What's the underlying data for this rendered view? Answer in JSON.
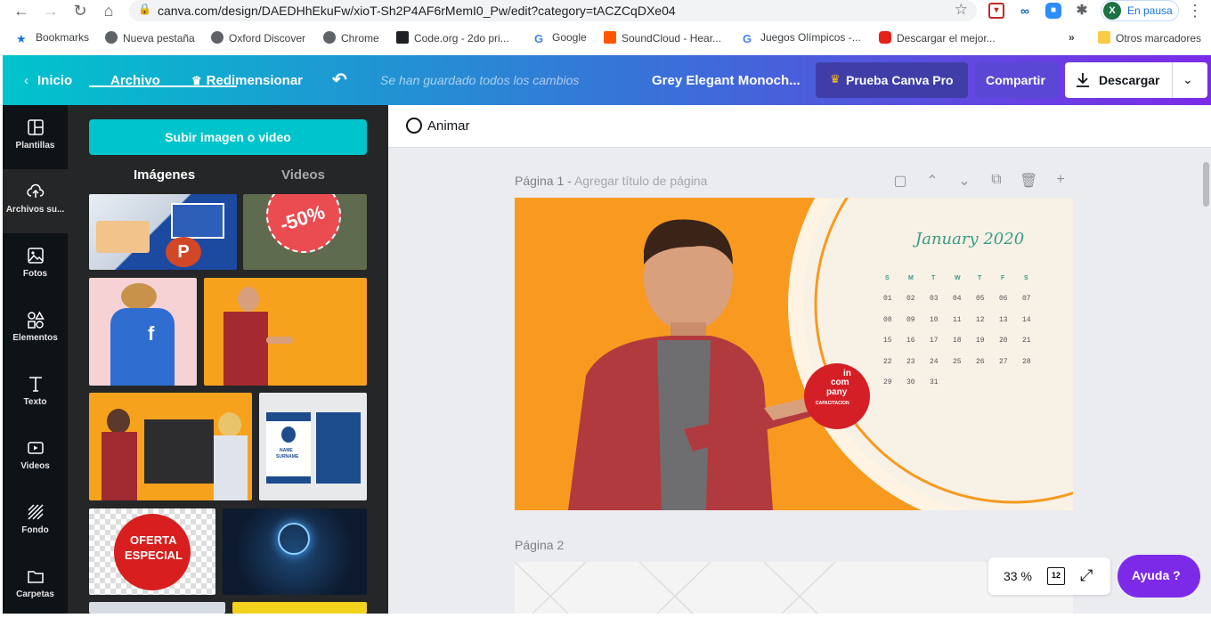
{
  "browser": {
    "url": "canva.com/design/DAEDHhEkuFw/xioT-Sh2P4AF6rMemI0_Pw/edit?category=tACZCqDXe04",
    "profile_status": "En pausa",
    "bookmarks": [
      {
        "label": "Bookmarks",
        "color": "#1a73e8"
      },
      {
        "label": "Nueva pestaña",
        "color": "#5f6368"
      },
      {
        "label": "Oxford Discover",
        "color": "#5f6368"
      },
      {
        "label": "Chrome",
        "color": "#5f6368"
      },
      {
        "label": "Code.org - 2do pri...",
        "color": "#202124"
      },
      {
        "label": "Google",
        "color": "#4285f4"
      },
      {
        "label": "SoundCloud - Hear...",
        "color": "#ff5500"
      },
      {
        "label": "Juegos Olímpicos -...",
        "color": "#4285f4"
      },
      {
        "label": "Descargar el mejor...",
        "color": "#e62117"
      }
    ],
    "more_bookmarks": "»",
    "other_bookmarks": "Otros marcadores"
  },
  "topbar": {
    "home": "Inicio",
    "file": "Archivo",
    "resize": "Redimensionar",
    "saved_status": "Se han guardado todos los cambios",
    "doc_title": "Grey Elegant Monoch...",
    "pro_button": "Prueba Canva Pro",
    "share_button": "Compartir",
    "download_button": "Descargar"
  },
  "sidebar": {
    "items": [
      {
        "label": "Plantillas",
        "icon": "templates-icon"
      },
      {
        "label": "Archivos su...",
        "icon": "upload-cloud-icon"
      },
      {
        "label": "Fotos",
        "icon": "photos-icon"
      },
      {
        "label": "Elementos",
        "icon": "elements-icon"
      },
      {
        "label": "Texto",
        "icon": "text-icon"
      },
      {
        "label": "Videos",
        "icon": "video-icon"
      },
      {
        "label": "Fondo",
        "icon": "background-icon"
      },
      {
        "label": "Carpetas",
        "icon": "folder-icon"
      }
    ]
  },
  "panel": {
    "upload_button": "Subir imagen o video",
    "tabs": [
      "Imágenes",
      "Videos"
    ],
    "thumb_texts": {
      "discount": "-50%",
      "offer": [
        "OFERTA",
        "ESPECIAL"
      ],
      "idcard": [
        "NAME",
        "SURNAME"
      ]
    }
  },
  "editor": {
    "animate": "Animar",
    "page1_label": "Página 1 - ",
    "page1_placeholder": "Agregar título de página",
    "page2_label": "Página 2",
    "zoom": "33 %",
    "page_count": "12",
    "help": "Ayuda ?"
  },
  "slide": {
    "month": "January 2020",
    "weekdays": [
      "S",
      "M",
      "T",
      "W",
      "T",
      "F",
      "S"
    ],
    "weeks": [
      [
        "01",
        "02",
        "03",
        "04",
        "05",
        "06",
        "07"
      ],
      [
        "08",
        "09",
        "10",
        "11",
        "12",
        "13",
        "14"
      ],
      [
        "15",
        "16",
        "17",
        "18",
        "19",
        "20",
        "21"
      ],
      [
        "22",
        "23",
        "24",
        "25",
        "26",
        "27",
        "28"
      ],
      [
        "29",
        "30",
        "31"
      ]
    ],
    "logo_text": [
      "in",
      "com",
      "pany",
      "CAPACITACION"
    ]
  }
}
